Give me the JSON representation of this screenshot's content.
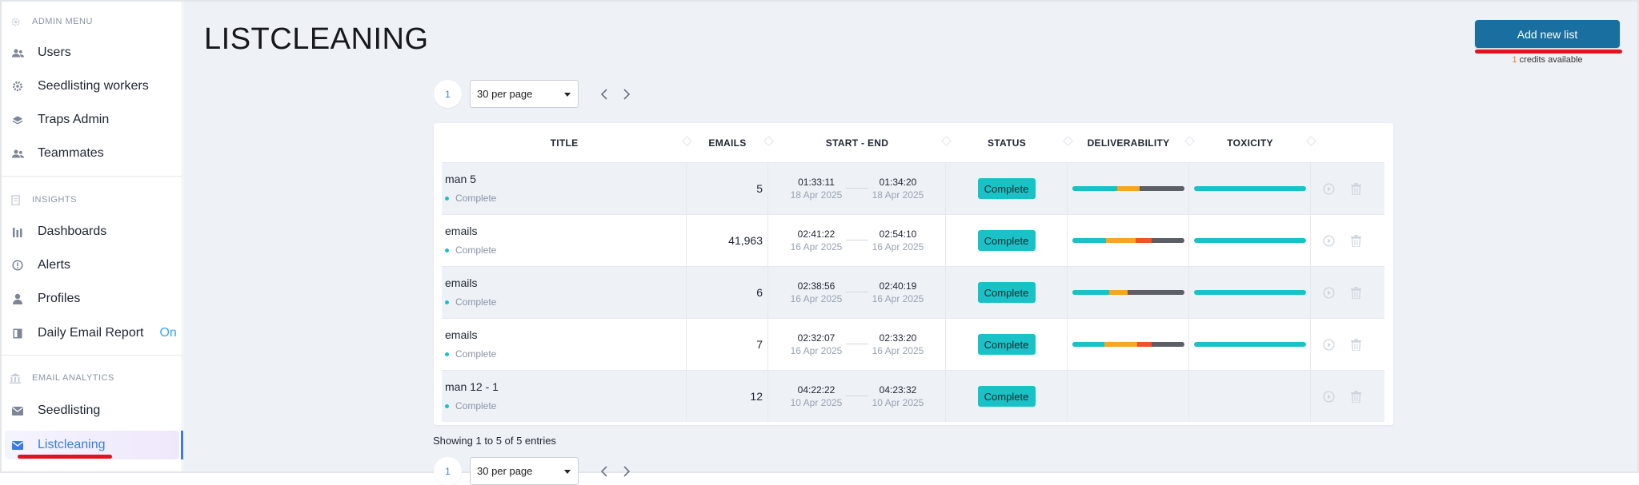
{
  "sidebar": {
    "sections": [
      {
        "title": "ADMIN MENU",
        "icon": "gear-icon"
      },
      {
        "title": "INSIGHTS",
        "icon": "document-icon"
      },
      {
        "title": "EMAIL ANALYTICS",
        "icon": "bank-icon"
      }
    ],
    "items": [
      {
        "label": "Users",
        "icon": "users-icon"
      },
      {
        "label": "Seedlisting workers",
        "icon": "gear-icon"
      },
      {
        "label": "Traps Admin",
        "icon": "layers-icon"
      },
      {
        "label": "Teammates",
        "icon": "users-icon"
      },
      {
        "label": "Dashboards",
        "icon": "bar-chart-icon"
      },
      {
        "label": "Alerts",
        "icon": "alert-circle-icon"
      },
      {
        "label": "Profiles",
        "icon": "person-icon"
      },
      {
        "label": "Daily Email Report",
        "icon": "report-icon",
        "badge": "On"
      },
      {
        "label": "Seedlisting",
        "icon": "envelope-icon"
      },
      {
        "label": "Listcleaning",
        "icon": "envelope-icon",
        "active": true
      }
    ]
  },
  "header": {
    "title": "LISTCLEANING",
    "add_button": "Add new list",
    "credits_count": "1",
    "credits_text": "credits available"
  },
  "pager": {
    "current_page": "1",
    "per_page": "30 per page",
    "prev_icon": "chevron-left-icon",
    "next_icon": "chevron-right-icon"
  },
  "table": {
    "columns": [
      "TITLE",
      "EMAILS",
      "START - END",
      "STATUS",
      "DELIVERABILITY",
      "TOXICITY"
    ],
    "rows": [
      {
        "title": "man 5",
        "state": "Complete",
        "emails": "5",
        "start_time": "01:33:11",
        "start_date": "18 Apr 2025",
        "end_time": "01:34:20",
        "end_date": "18 Apr 2025",
        "status": "Complete",
        "deliverability": [
          {
            "pct": 40,
            "color": "#19c2c6"
          },
          {
            "pct": 20,
            "color": "#f5a623"
          },
          {
            "pct": 40,
            "color": "#5c5f66"
          }
        ],
        "toxicity": [
          {
            "pct": 100,
            "color": "#19c2c6"
          }
        ]
      },
      {
        "title": "emails",
        "state": "Complete",
        "emails": "41,963",
        "start_time": "02:41:22",
        "start_date": "16 Apr 2025",
        "end_time": "02:54:10",
        "end_date": "16 Apr 2025",
        "status": "Complete",
        "deliverability": [
          {
            "pct": 30,
            "color": "#19c2c6"
          },
          {
            "pct": 27,
            "color": "#f5a623"
          },
          {
            "pct": 14,
            "color": "#f0532a"
          },
          {
            "pct": 29,
            "color": "#5c5f66"
          }
        ],
        "toxicity": [
          {
            "pct": 100,
            "color": "#19c2c6"
          }
        ]
      },
      {
        "title": "emails",
        "state": "Complete",
        "emails": "6",
        "start_time": "02:38:56",
        "start_date": "16 Apr 2025",
        "end_time": "02:40:19",
        "end_date": "16 Apr 2025",
        "status": "Complete",
        "deliverability": [
          {
            "pct": 33,
            "color": "#19c2c6"
          },
          {
            "pct": 17,
            "color": "#f5a623"
          },
          {
            "pct": 50,
            "color": "#5c5f66"
          }
        ],
        "toxicity": [
          {
            "pct": 100,
            "color": "#19c2c6"
          }
        ]
      },
      {
        "title": "emails",
        "state": "Complete",
        "emails": "7",
        "start_time": "02:32:07",
        "start_date": "16 Apr 2025",
        "end_time": "02:33:20",
        "end_date": "16 Apr 2025",
        "status": "Complete",
        "deliverability": [
          {
            "pct": 29,
            "color": "#19c2c6"
          },
          {
            "pct": 29,
            "color": "#f5a623"
          },
          {
            "pct": 13,
            "color": "#f0532a"
          },
          {
            "pct": 29,
            "color": "#5c5f66"
          }
        ],
        "toxicity": [
          {
            "pct": 100,
            "color": "#19c2c6"
          }
        ]
      },
      {
        "title": "man 12 - 1",
        "state": "Complete",
        "emails": "12",
        "start_time": "04:22:22",
        "start_date": "10 Apr 2025",
        "end_time": "04:23:32",
        "end_date": "10 Apr 2025",
        "status": "Complete",
        "deliverability": [],
        "toxicity": []
      }
    ]
  },
  "footer": {
    "showing": "Showing 1 to 5 of 5 entries"
  }
}
